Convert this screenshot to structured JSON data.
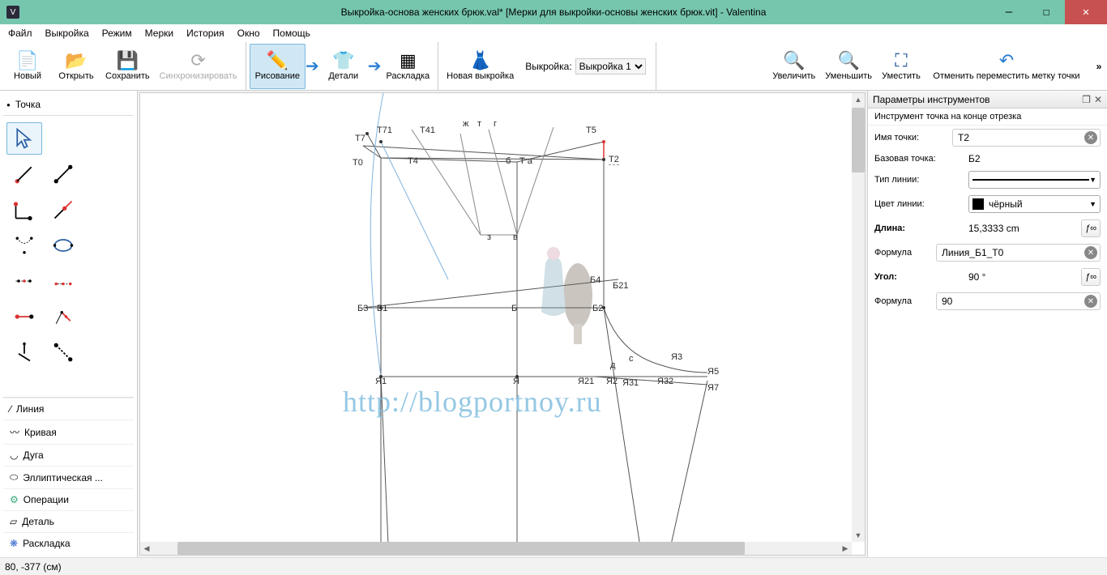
{
  "title": "Выкройка-основа женских брюк.val* [Мерки для выкройки-основы женских брюк.vit] - Valentina",
  "menu": [
    "Файл",
    "Выкройка",
    "Режим",
    "Мерки",
    "История",
    "Окно",
    "Помощь"
  ],
  "toolbar": {
    "new": "Новый",
    "open": "Открыть",
    "save": "Сохранить",
    "sync": "Синхронизировать",
    "draw": "Рисование",
    "details": "Детали",
    "layout": "Раскладка",
    "newpattern": "Новая выкройка",
    "pattern_label": "Выкройка:",
    "pattern_value": "Выкройка 1",
    "zoomin": "Увеличить",
    "zoomout": "Уменьшить",
    "zoomfit": "Уместить",
    "undo": "Отменить переместить метку точки"
  },
  "left": {
    "header": "Точка",
    "cats": [
      "Линия",
      "Кривая",
      "Дуга",
      "Эллиптическая ...",
      "Операции",
      "Деталь",
      "Раскладка"
    ]
  },
  "right": {
    "title": "Параметры инструментов",
    "tool": "Инструмент точка на конце отрезка",
    "lbl_name": "Имя точки:",
    "val_name": "T2",
    "lbl_base": "Базовая точка:",
    "val_base": "Б2",
    "lbl_ltype": "Тип линии:",
    "lbl_lcolor": "Цвет линии:",
    "val_lcolor": "чёрный",
    "lbl_len": "Длина:",
    "val_len": "15,3333 cm",
    "lbl_formula": "Формула",
    "val_formula_len": "Линия_Б1_Т0",
    "lbl_angle": "Угол:",
    "val_angle": "90 °",
    "val_formula_ang": "90"
  },
  "status": "80, -377 (см)",
  "watermark": "http://blogportnoy.ru",
  "points": {
    "T7": "T7",
    "T0": "T0",
    "T71": "T71",
    "T4": "T4",
    "T41": "T41",
    "zh": "ж",
    "t": "т",
    "g": "г",
    "T5": "T5",
    "b": "б",
    "Ta": "Т а",
    "T2": "Т2",
    "z": "з",
    "v": "в",
    "B4": "Б4",
    "B21": "Б21",
    "B3": "Б3",
    "B1": "Б1",
    "Blc": "Б",
    "B2": "Б2",
    "Ya1": "Я1",
    "Ya": "Я",
    "Ya21": "Я21",
    "Ya2": "Я2",
    "Ya31": "Я31",
    "Ya32": "Я32",
    "d": "д",
    "c": "с",
    "Ya3": "Я3",
    "Ya5": "Я5",
    "Ya7": "Я7"
  }
}
